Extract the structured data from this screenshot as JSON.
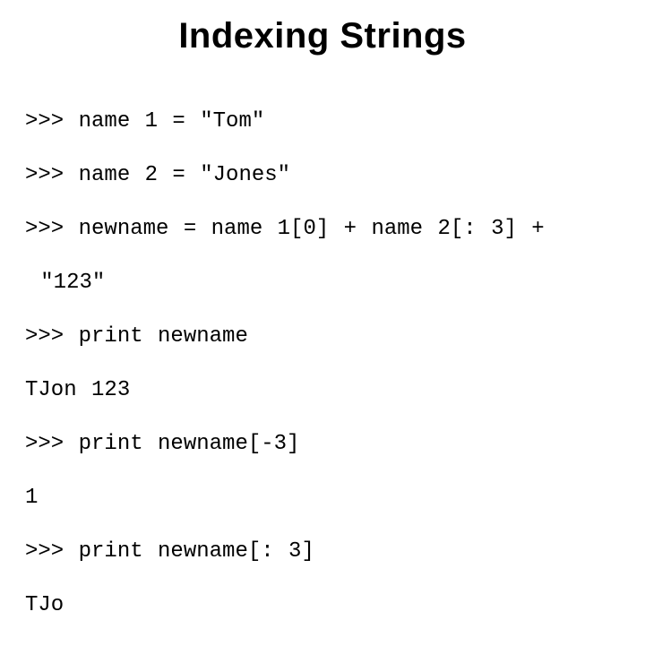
{
  "title": "Indexing Strings",
  "code": {
    "l1": ">>> name 1 = \"Tom\"",
    "l2": ">>> name 2 = \"Jones\"",
    "l3": ">>> newname = name 1[0] + name 2[: 3] + ",
    "l3b": "\"123\"",
    "l4": ">>> print newname",
    "l5": "TJon 123",
    "l6": ">>> print newname[-3]",
    "l7": "1",
    "l8": ">>> print newname[: 3]",
    "l9": "TJo"
  }
}
